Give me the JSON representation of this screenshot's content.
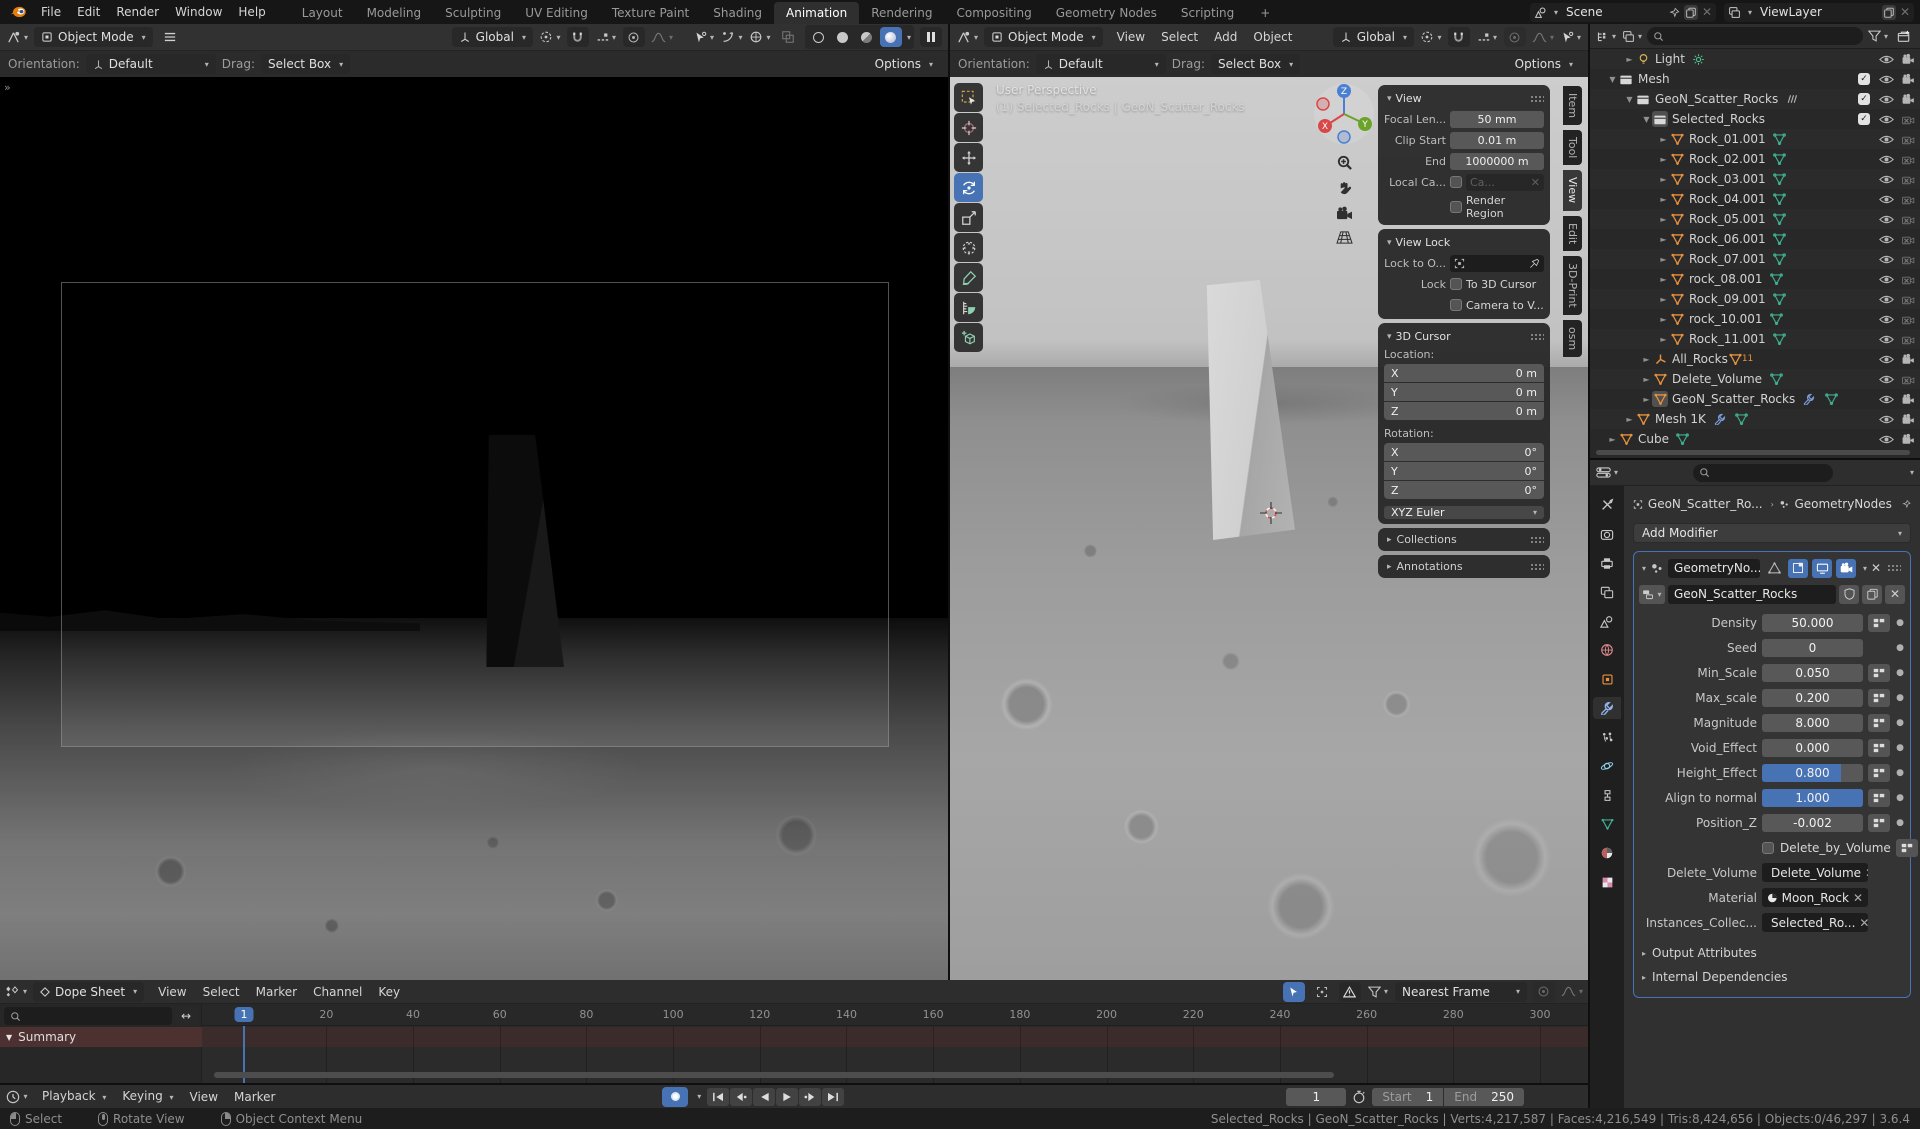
{
  "topbar": {
    "menus": [
      "File",
      "Edit",
      "Render",
      "Window",
      "Help"
    ],
    "workspaces": [
      "Layout",
      "Modeling",
      "Sculpting",
      "UV Editing",
      "Texture Paint",
      "Shading",
      "Animation",
      "Rendering",
      "Compositing",
      "Geometry Nodes",
      "Scripting"
    ],
    "active_workspace": "Animation",
    "new_workspace": "+",
    "scene": {
      "value": "Scene"
    },
    "view_layer": {
      "value": "ViewLayer"
    }
  },
  "vp_left": {
    "mode": "Object Mode",
    "orientation": "Global",
    "ts": {
      "orientation_label": "Orientation:",
      "orientation_value": "Default",
      "drag_label": "Drag:",
      "drag_value": "Select Box",
      "options": "Options"
    }
  },
  "vp_right": {
    "mode": "Object Mode",
    "menus": [
      "View",
      "Select",
      "Add",
      "Object"
    ],
    "orientation": "Global",
    "ts": {
      "orientation_label": "Orientation:",
      "orientation_value": "Default",
      "drag_label": "Drag:",
      "drag_value": "Select Box",
      "options": "Options"
    },
    "overlay1": "User Perspective",
    "overlay2": "(1) Selected_Rocks | GeoN_Scatter_Rocks",
    "toolbar": [
      {
        "name": "select-box",
        "active": false
      },
      {
        "name": "cursor",
        "active": false
      },
      {
        "name": "move",
        "active": false
      },
      {
        "name": "rotate",
        "active": true
      },
      {
        "name": "scale",
        "active": false
      },
      {
        "name": "transform",
        "active": false
      },
      {
        "name": "annotate",
        "active": false
      },
      {
        "name": "measure",
        "active": false
      },
      {
        "name": "add-cube",
        "active": false
      }
    ],
    "sidebar_tabs": [
      {
        "label": "Item",
        "active": false
      },
      {
        "label": "Tool",
        "active": false
      },
      {
        "label": "View",
        "active": true
      },
      {
        "label": "Edit",
        "active": false
      },
      {
        "label": "3D-Print",
        "active": false
      },
      {
        "label": "osm",
        "active": false
      }
    ],
    "npanel": {
      "view": {
        "title": "View",
        "focal_label": "Focal Len...",
        "focal_value": "50 mm",
        "clip_label": "Clip Start",
        "clip_value": "0.01 m",
        "end_label": "End",
        "end_value": "1000000 m",
        "local_label": "Local Ca...",
        "local_value": "Ca...",
        "render_region": "Render Region"
      },
      "view_lock": {
        "title": "View Lock",
        "lock_to_label": "Lock to O...",
        "lock_label": "Lock",
        "to_3d_cursor": "To 3D Cursor",
        "camera_to_view": "Camera to V..."
      },
      "cursor": {
        "title": "3D Cursor",
        "location_label": "Location:",
        "rotation_label": "Rotation:",
        "location": [
          {
            "axis": "X",
            "value": "0 m"
          },
          {
            "axis": "Y",
            "value": "0 m"
          },
          {
            "axis": "Z",
            "value": "0 m"
          }
        ],
        "rotation": [
          {
            "axis": "X",
            "value": "0°"
          },
          {
            "axis": "Y",
            "value": "0°"
          },
          {
            "axis": "Z",
            "value": "0°"
          }
        ],
        "euler": "XYZ Euler"
      },
      "collections_label": "Collections",
      "annotations_label": "Annotations"
    }
  },
  "outliner": {
    "rows": [
      {
        "label": "Light",
        "level": 2,
        "icon": "light",
        "arrow": "closed",
        "extras": [
          "light-data"
        ],
        "toggles": [
          "eye",
          "camera"
        ]
      },
      {
        "label": "Mesh",
        "level": 1,
        "icon": "collection",
        "arrow": "open",
        "toggles": [
          "check",
          "eye",
          "camera"
        ]
      },
      {
        "label": "GeoN_Scatter_Rocks",
        "level": 2,
        "icon": "collection",
        "arrow": "open",
        "extras": [
          "stack"
        ],
        "toggles": [
          "check",
          "eye",
          "camera"
        ]
      },
      {
        "label": "Selected_Rocks",
        "level": 3,
        "icon": "collection",
        "arrow": "open",
        "active": true,
        "toggles": [
          "check",
          "eye",
          "camera-x"
        ]
      },
      {
        "label": "Rock_01.001",
        "level": 4,
        "icon": "mesh",
        "arrow": "closed",
        "extras": [
          "geonodes"
        ],
        "toggles": [
          "eye",
          "camera-x"
        ]
      },
      {
        "label": "Rock_02.001",
        "level": 4,
        "icon": "mesh",
        "arrow": "closed",
        "extras": [
          "geonodes"
        ],
        "toggles": [
          "eye",
          "camera-x"
        ]
      },
      {
        "label": "Rock_03.001",
        "level": 4,
        "icon": "mesh",
        "arrow": "closed",
        "extras": [
          "geonodes"
        ],
        "toggles": [
          "eye",
          "camera-x"
        ]
      },
      {
        "label": "Rock_04.001",
        "level": 4,
        "icon": "mesh",
        "arrow": "closed",
        "extras": [
          "geonodes"
        ],
        "toggles": [
          "eye",
          "camera-x"
        ]
      },
      {
        "label": "Rock_05.001",
        "level": 4,
        "icon": "mesh",
        "arrow": "closed",
        "extras": [
          "geonodes"
        ],
        "toggles": [
          "eye",
          "camera-x"
        ]
      },
      {
        "label": "Rock_06.001",
        "level": 4,
        "icon": "mesh",
        "arrow": "closed",
        "extras": [
          "geonodes"
        ],
        "toggles": [
          "eye",
          "camera-x"
        ]
      },
      {
        "label": "Rock_07.001",
        "level": 4,
        "icon": "mesh",
        "arrow": "closed",
        "extras": [
          "geonodes"
        ],
        "toggles": [
          "eye",
          "camera-x"
        ]
      },
      {
        "label": "rock_08.001",
        "level": 4,
        "icon": "mesh",
        "arrow": "closed",
        "extras": [
          "geonodes"
        ],
        "toggles": [
          "eye",
          "camera-x"
        ]
      },
      {
        "label": "Rock_09.001",
        "level": 4,
        "icon": "mesh",
        "arrow": "closed",
        "extras": [
          "geonodes"
        ],
        "toggles": [
          "eye",
          "camera-x"
        ]
      },
      {
        "label": "rock_10.001",
        "level": 4,
        "icon": "mesh",
        "arrow": "closed",
        "extras": [
          "geonodes"
        ],
        "toggles": [
          "eye",
          "camera-x"
        ]
      },
      {
        "label": "Rock_11.001",
        "level": 4,
        "icon": "mesh",
        "arrow": "closed",
        "extras": [
          "geonodes"
        ],
        "toggles": [
          "eye",
          "camera-x"
        ]
      },
      {
        "label": "All_Rocks",
        "level": 3,
        "icon": "empty",
        "arrow": "closed",
        "extras": [
          "mesh-badge"
        ],
        "badge": "11",
        "toggles": [
          "eye",
          "camera"
        ]
      },
      {
        "label": "Delete_Volume",
        "level": 3,
        "icon": "mesh",
        "arrow": "closed",
        "extras": [
          "geonodes"
        ],
        "toggles": [
          "eye",
          "camera-x"
        ]
      },
      {
        "label": "GeoN_Scatter_Rocks",
        "level": 3,
        "icon": "mesh",
        "arrow": "closed",
        "active": true,
        "extras": [
          "wrench",
          "geonodes"
        ],
        "toggles": [
          "eye",
          "camera"
        ]
      },
      {
        "label": "Mesh 1K",
        "level": 2,
        "icon": "mesh",
        "arrow": "closed",
        "extras": [
          "wrench",
          "geonodes"
        ],
        "toggles": [
          "eye",
          "camera"
        ]
      },
      {
        "label": "Cube",
        "level": 1,
        "icon": "mesh",
        "arrow": "closed",
        "extras": [
          "geonodes"
        ],
        "toggles": [
          "eye",
          "camera"
        ]
      }
    ]
  },
  "properties": {
    "tabs": [
      "tool",
      "render",
      "output",
      "view-layer",
      "scene",
      "world",
      "object",
      "modifiers",
      "particles",
      "physics",
      "constraints",
      "data",
      "material",
      "texture"
    ],
    "active_tab": "modifiers",
    "breadcrumb": {
      "object": "GeoN_Scatter_Ro...",
      "data": "GeometryNodes"
    },
    "add_modifier": "Add Modifier",
    "modifier": {
      "name": "GeometryNo...",
      "node_group": "GeoN_Scatter_Rocks",
      "fields": [
        {
          "label": "Density",
          "value": "50.000",
          "attr": true,
          "fill": 0
        },
        {
          "label": "Seed",
          "value": "0",
          "attr": false,
          "fill": 0
        },
        {
          "label": "Min_Scale",
          "value": "0.050",
          "attr": true,
          "fill": 0
        },
        {
          "label": "Max_scale",
          "value": "0.200",
          "attr": true,
          "fill": 0
        },
        {
          "label": "Magnitude",
          "value": "8.000",
          "attr": true,
          "fill": 0
        },
        {
          "label": "Void_Effect",
          "value": "0.000",
          "attr": true,
          "fill": 0
        },
        {
          "label": "Height_Effect",
          "value": "0.800",
          "attr": true,
          "fill": 0.78
        },
        {
          "label": "Align to normal",
          "value": "1.000",
          "attr": true,
          "fill": 1
        },
        {
          "label": "Position_Z",
          "value": "-0.002",
          "attr": true,
          "fill": 0
        }
      ],
      "delete_by_volume": "Delete_by_Volume",
      "object_field_label": "Delete_Volume",
      "object_field_value": "Delete_Volume",
      "material_label": "Material",
      "material_value": "Moon_Rock",
      "collection_label": "Instances_Collec...",
      "collection_value": "Selected_Ro...",
      "sections": [
        "Output Attributes",
        "Internal Dependencies"
      ]
    }
  },
  "dopesheet": {
    "editor": "Dope Sheet",
    "menus": [
      "View",
      "Select",
      "Marker",
      "Channel",
      "Key"
    ],
    "snap": "Nearest Frame",
    "summary": "Summary",
    "current_frame": "1",
    "frames": [
      20,
      40,
      60,
      80,
      100,
      120,
      140,
      160,
      180,
      200,
      220,
      240,
      260,
      280,
      300
    ]
  },
  "timeline": {
    "menus": [
      "Playback",
      "Keying",
      "View",
      "Marker"
    ],
    "frame": "1",
    "start_label": "Start",
    "start_value": "1",
    "end_label": "End",
    "end_value": "250"
  },
  "statusbar": {
    "hints": [
      "Select",
      "Rotate View",
      "Object Context Menu"
    ],
    "stats": "Selected_Rocks | GeoN_Scatter_Rocks | Verts:4,217,587 | Faces:4,216,549 | Tris:8,424,656 | Objects:0/46,297 | 3.6.4"
  },
  "colors": {
    "accent": "#4772b3",
    "object_orange": "#e8913c",
    "geonodes_green": "#3fae8f",
    "wrench_blue": "#7b9bd8"
  }
}
